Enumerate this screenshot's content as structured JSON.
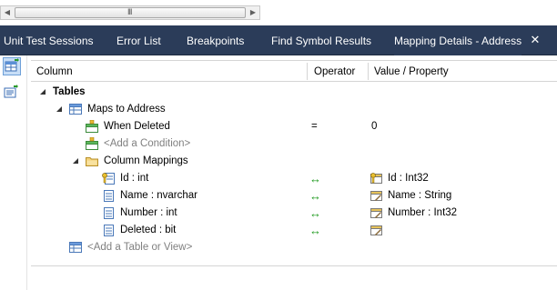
{
  "scrollbar": {
    "grip": "III"
  },
  "tabs": [
    {
      "label": "Unit Test Sessions"
    },
    {
      "label": "Error List"
    },
    {
      "label": "Breakpoints"
    },
    {
      "label": "Find Symbol Results"
    },
    {
      "label": "Mapping Details - Address"
    }
  ],
  "active_tab": "Mapping Details - Address",
  "grid": {
    "headers": {
      "column": "Column",
      "operator": "Operator",
      "value": "Value / Property"
    },
    "rows": {
      "tables": {
        "label": "Tables"
      },
      "maps_to": {
        "label": "Maps to Address"
      },
      "when_deleted": {
        "label": "When Deleted",
        "operator": "=",
        "value": "0"
      },
      "add_condition": {
        "label": "<Add a Condition>"
      },
      "column_mappings": {
        "label": "Column Mappings"
      },
      "id": {
        "label": "Id : int",
        "operator": "↔",
        "value": "Id : Int32"
      },
      "name": {
        "label": "Name : nvarchar",
        "operator": "↔",
        "value": "Name : String"
      },
      "number": {
        "label": "Number : int",
        "operator": "↔",
        "value": "Number : Int32"
      },
      "deleted": {
        "label": "Deleted : bit",
        "operator": "↔",
        "value": ""
      },
      "add_table": {
        "label": "<Add a Table or View>"
      }
    }
  },
  "colors": {
    "tabstrip": "#2b3c59",
    "mapping_arrow": "#1e9a1e",
    "placeholder_text": "#808080"
  }
}
